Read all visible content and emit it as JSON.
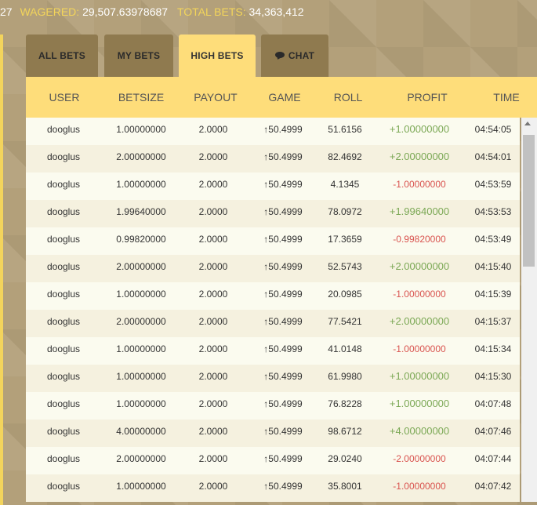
{
  "topbar": {
    "prefix": "27",
    "wagered_label": "WAGERED:",
    "wagered_value": "29,507.63978687",
    "total_bets_label": "TOTAL BETS:",
    "total_bets_value": "34,363,412"
  },
  "tabs": [
    {
      "label": "ALL BETS",
      "active": false
    },
    {
      "label": "MY BETS",
      "active": false
    },
    {
      "label": "HIGH BETS",
      "active": true
    },
    {
      "label": "CHAT",
      "active": false,
      "icon": "chat-bubble-icon"
    }
  ],
  "columns": [
    "USER",
    "BETSIZE",
    "PAYOUT",
    "GAME",
    "ROLL",
    "PROFIT",
    "TIME"
  ],
  "rows": [
    {
      "user": "dooglus",
      "betsize": "1.00000000",
      "payout": "2.0000",
      "game": "↑50.4999",
      "roll": "51.6156",
      "profit": "+1.00000000",
      "time": "04:54:05"
    },
    {
      "user": "dooglus",
      "betsize": "2.00000000",
      "payout": "2.0000",
      "game": "↑50.4999",
      "roll": "82.4692",
      "profit": "+2.00000000",
      "time": "04:54:01"
    },
    {
      "user": "dooglus",
      "betsize": "1.00000000",
      "payout": "2.0000",
      "game": "↑50.4999",
      "roll": "4.1345",
      "profit": "-1.00000000",
      "time": "04:53:59"
    },
    {
      "user": "dooglus",
      "betsize": "1.99640000",
      "payout": "2.0000",
      "game": "↑50.4999",
      "roll": "78.0972",
      "profit": "+1.99640000",
      "time": "04:53:53"
    },
    {
      "user": "dooglus",
      "betsize": "0.99820000",
      "payout": "2.0000",
      "game": "↑50.4999",
      "roll": "17.3659",
      "profit": "-0.99820000",
      "time": "04:53:49"
    },
    {
      "user": "dooglus",
      "betsize": "2.00000000",
      "payout": "2.0000",
      "game": "↑50.4999",
      "roll": "52.5743",
      "profit": "+2.00000000",
      "time": "04:15:40"
    },
    {
      "user": "dooglus",
      "betsize": "1.00000000",
      "payout": "2.0000",
      "game": "↑50.4999",
      "roll": "20.0985",
      "profit": "-1.00000000",
      "time": "04:15:39"
    },
    {
      "user": "dooglus",
      "betsize": "2.00000000",
      "payout": "2.0000",
      "game": "↑50.4999",
      "roll": "77.5421",
      "profit": "+2.00000000",
      "time": "04:15:37"
    },
    {
      "user": "dooglus",
      "betsize": "1.00000000",
      "payout": "2.0000",
      "game": "↑50.4999",
      "roll": "41.0148",
      "profit": "-1.00000000",
      "time": "04:15:34"
    },
    {
      "user": "dooglus",
      "betsize": "1.00000000",
      "payout": "2.0000",
      "game": "↑50.4999",
      "roll": "61.9980",
      "profit": "+1.00000000",
      "time": "04:15:30"
    },
    {
      "user": "dooglus",
      "betsize": "1.00000000",
      "payout": "2.0000",
      "game": "↑50.4999",
      "roll": "76.8228",
      "profit": "+1.00000000",
      "time": "04:07:48"
    },
    {
      "user": "dooglus",
      "betsize": "4.00000000",
      "payout": "2.0000",
      "game": "↑50.4999",
      "roll": "98.6712",
      "profit": "+4.00000000",
      "time": "04:07:46"
    },
    {
      "user": "dooglus",
      "betsize": "2.00000000",
      "payout": "2.0000",
      "game": "↑50.4999",
      "roll": "29.0240",
      "profit": "-2.00000000",
      "time": "04:07:44"
    },
    {
      "user": "dooglus",
      "betsize": "1.00000000",
      "payout": "2.0000",
      "game": "↑50.4999",
      "roll": "35.8001",
      "profit": "-1.00000000",
      "time": "04:07:42"
    }
  ],
  "colors": {
    "header_bg": "#fedd7a",
    "tab_bg": "#8f7a4f",
    "label_gold": "#f3d55a",
    "profit_positive": "#7ba855",
    "profit_negative": "#d9534f"
  }
}
